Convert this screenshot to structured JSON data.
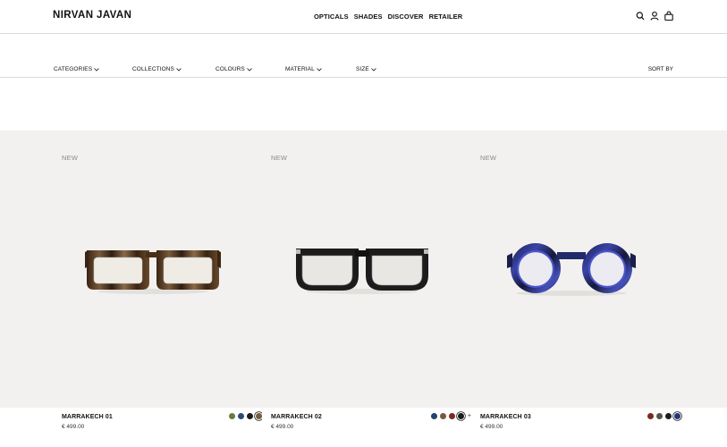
{
  "brand": "NIRVAN JAVAN",
  "nav": [
    "OPTICALS",
    "SHADES",
    "DISCOVER",
    "RETAILER"
  ],
  "icons": [
    "search-icon",
    "user-icon",
    "bag-icon"
  ],
  "filters": [
    "CATEGORIES",
    "COLLECTIONS",
    "COLOURS",
    "MATERIAL",
    "SIZE"
  ],
  "sort_label": "SORT BY",
  "products": [
    {
      "badge": "NEW",
      "name": "MARRAKECH 01",
      "price": "€ 499.00",
      "swatches": [
        "#6b7a3c",
        "#2c4a7a",
        "#1c1c1c",
        "#7a5a3c"
      ],
      "selected_swatch": 3,
      "more": ""
    },
    {
      "badge": "NEW",
      "name": "MARRAKECH 02",
      "price": "€ 499.00",
      "swatches": [
        "#24436e",
        "#7a5a3c",
        "#7a2a22",
        "#1c1c1c"
      ],
      "selected_swatch": 3,
      "more": "+"
    },
    {
      "badge": "NEW",
      "name": "MARRAKECH 03",
      "price": "€ 499.00",
      "swatches": [
        "#7a2a22",
        "#5a5248",
        "#1c1c1c",
        "#24367a"
      ],
      "selected_swatch": 3,
      "more": ""
    }
  ],
  "colors": {
    "grid_bg": "#f2f1ef",
    "frame_tortoise": "#5a3a22",
    "frame_black": "#1c1c1c",
    "frame_blue": "#2a2f7a"
  }
}
